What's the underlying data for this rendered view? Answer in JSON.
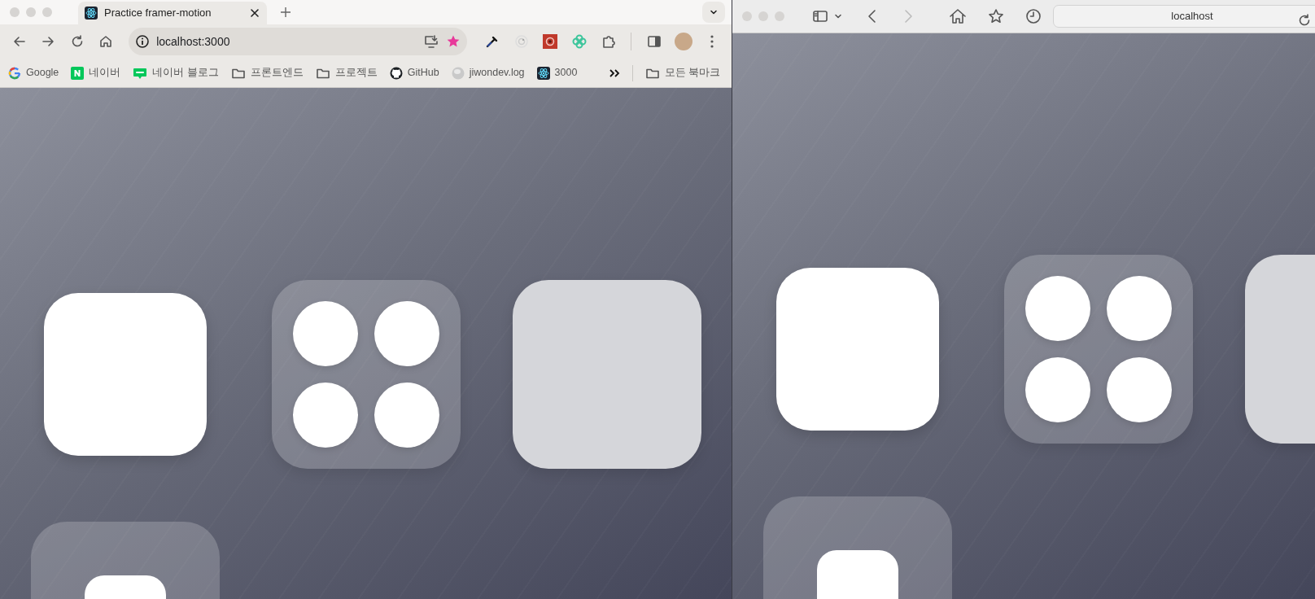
{
  "chrome": {
    "tab": {
      "title": "Practice framer-motion"
    },
    "address": "localhost:3000",
    "bookmarked": true,
    "bookmarks": [
      {
        "label": "Google",
        "kind": "google"
      },
      {
        "label": "네이버",
        "kind": "naver"
      },
      {
        "label": "네이버 블로그",
        "kind": "blog"
      },
      {
        "label": "프론트엔드",
        "kind": "folder"
      },
      {
        "label": "프로젝트",
        "kind": "folder"
      },
      {
        "label": "GitHub",
        "kind": "github"
      },
      {
        "label": "jiwondev.log",
        "kind": "globe"
      },
      {
        "label": "3000",
        "kind": "react"
      }
    ],
    "all_bookmarks": {
      "label": "모든 북마크"
    },
    "cards": [
      {
        "kind": "solid"
      },
      {
        "kind": "dots"
      },
      {
        "kind": "light"
      },
      {
        "kind": "nested"
      }
    ]
  },
  "safari": {
    "address": "localhost",
    "cards": [
      {
        "kind": "solid"
      },
      {
        "kind": "dots"
      },
      {
        "kind": "light"
      },
      {
        "kind": "nested"
      }
    ]
  }
}
